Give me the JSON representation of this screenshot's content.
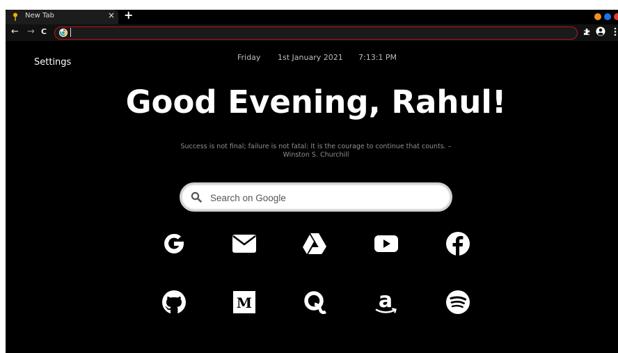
{
  "browser": {
    "tab": {
      "title": "New Tab",
      "close": "×",
      "favicon": "pin-icon"
    },
    "new_tab": "+",
    "window_dots": [
      "#f7901e",
      "#1a73e8",
      "#e53935"
    ],
    "toolbar": {
      "back": "←",
      "forward": "→",
      "reload": "C",
      "omnibox_value": "",
      "extensions": "puzzle-icon",
      "profile": "account-icon",
      "menu": "kebab-menu-icon",
      "omnibox_border_color": "#c0141a"
    }
  },
  "page": {
    "settings_label": "Settings",
    "date": {
      "day": "Friday",
      "full_date": "1st January 2021",
      "time": "7:13:1 PM"
    },
    "greeting": "Good Evening, Rahul!",
    "quote": {
      "text": "Success is not final; failure is not fatal: It is the courage to continue that counts. –",
      "author": "Winston S. Churchill"
    },
    "search": {
      "placeholder": "Search on Google",
      "icon": "search-icon"
    },
    "shortcuts_row1": [
      "google-icon",
      "gmail-icon",
      "google-drive-icon",
      "youtube-icon",
      "facebook-icon"
    ],
    "shortcuts_row2": [
      "github-icon",
      "medium-icon",
      "quora-icon",
      "amazon-icon",
      "spotify-icon"
    ],
    "background_color": "#000000",
    "text_color": "#ffffff"
  }
}
